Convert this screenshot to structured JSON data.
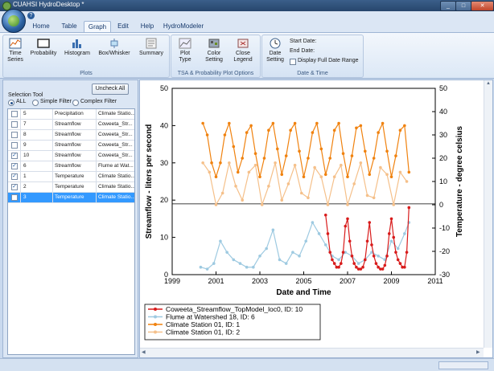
{
  "window": {
    "title": "CUAHSI HydroDesktop *"
  },
  "quick_access": {
    "help_glyph": "?"
  },
  "tabs": [
    {
      "label": "Home",
      "active": false
    },
    {
      "label": "Table",
      "active": false
    },
    {
      "label": "Graph",
      "active": true
    },
    {
      "label": "Edit",
      "active": false
    },
    {
      "label": "Help",
      "active": false
    },
    {
      "label": "HydroModeler",
      "active": false
    }
  ],
  "ribbon": {
    "plots_group": {
      "label": "Plots",
      "buttons": [
        {
          "label": "Time Series",
          "icon": "time-series-icon"
        },
        {
          "label": "Probability",
          "icon": "probability-icon"
        },
        {
          "label": "Histogram",
          "icon": "histogram-icon"
        },
        {
          "label": "Box/Whisker",
          "icon": "box-whisker-icon"
        },
        {
          "label": "Summary",
          "icon": "summary-icon"
        }
      ]
    },
    "options_group": {
      "label": "TSA & Probability Plot Options",
      "buttons": [
        {
          "label": "Plot Type",
          "icon": "plot-type-icon"
        },
        {
          "label": "Color Setting",
          "icon": "color-setting-icon"
        },
        {
          "label": "Close Legend",
          "icon": "close-legend-icon"
        }
      ]
    },
    "date_group": {
      "label": "Date & Time",
      "date_setting_label": "Date Setting",
      "start_date_label": "Start Date:",
      "end_date_label": "End Date:",
      "display_full_label": "Display Full Date Range"
    }
  },
  "left_panel": {
    "uncheck_all": "Uncheck All",
    "selection_tool": "Selection Tool",
    "filters": [
      {
        "label": "ALL",
        "selected": true
      },
      {
        "label": "Simple Filter",
        "selected": false
      },
      {
        "label": "Complex Filter",
        "selected": false
      }
    ],
    "rows": [
      {
        "checked": false,
        "id": "5",
        "variable": "Precipitation",
        "site": "Climate Statio...",
        "selected": false
      },
      {
        "checked": false,
        "id": "7",
        "variable": "Streamflow",
        "site": "Coweeta_Str...",
        "selected": false
      },
      {
        "checked": false,
        "id": "8",
        "variable": "Streamflow",
        "site": "Coweeta_Str...",
        "selected": false
      },
      {
        "checked": false,
        "id": "9",
        "variable": "Streamflow",
        "site": "Coweeta_Str...",
        "selected": false
      },
      {
        "checked": true,
        "id": "10",
        "variable": "Streamflow",
        "site": "Coweeta_Str...",
        "selected": false
      },
      {
        "checked": true,
        "id": "6",
        "variable": "Streamflow",
        "site": "Flume at Wat...",
        "selected": false
      },
      {
        "checked": true,
        "id": "1",
        "variable": "Temperature",
        "site": "Climate Statio...",
        "selected": false
      },
      {
        "checked": true,
        "id": "2",
        "variable": "Temperature",
        "site": "Climate Statio...",
        "selected": false
      },
      {
        "checked": false,
        "id": "3",
        "variable": "Temperature",
        "site": "Climate Statio...",
        "selected": true
      }
    ]
  },
  "chart_data": {
    "type": "scatter",
    "xlabel": "Date and Time",
    "ylabel": "Streamflow - liters per second",
    "y2label": "Temperature - degree celsius",
    "xlim": [
      1999,
      2011
    ],
    "ylim": [
      0,
      50
    ],
    "y2lim": [
      -30,
      50
    ],
    "x_ticks": [
      "1999",
      "2001",
      "2003",
      "2005",
      "2007",
      "2009",
      "2011"
    ],
    "y_ticks": [
      "0",
      "10",
      "20",
      "30",
      "40",
      "50"
    ],
    "y2_ticks": [
      "-30",
      "-20",
      "-10",
      "0",
      "10",
      "20",
      "30",
      "40",
      "50"
    ],
    "reference_line_y": 19,
    "legend_position": "bottom-left",
    "series": [
      {
        "name": "Coweeta_Streamflow_TopModel_loc0, ID: 10",
        "color": "#d81b1b",
        "axis": "left",
        "x": [
          2006.0,
          2006.1,
          2006.2,
          2006.3,
          2006.4,
          2006.5,
          2006.6,
          2006.7,
          2006.8,
          2006.9,
          2007.0,
          2007.1,
          2007.2,
          2007.3,
          2007.4,
          2007.5,
          2007.6,
          2007.7,
          2007.8,
          2007.9,
          2008.0,
          2008.1,
          2008.2,
          2008.3,
          2008.4,
          2008.5,
          2008.6,
          2008.7,
          2008.8,
          2008.9,
          2009.0,
          2009.1,
          2009.2,
          2009.3,
          2009.4,
          2009.5,
          2009.6,
          2009.7,
          2009.8
        ],
        "y": [
          16,
          11,
          6,
          4,
          3,
          2,
          2,
          3,
          6,
          13,
          15,
          9,
          5,
          3,
          2,
          1.5,
          1.5,
          2,
          4,
          9,
          14,
          8,
          5,
          3,
          2,
          1.5,
          1.5,
          2.5,
          5,
          11,
          15,
          10,
          6,
          4,
          3,
          2,
          2,
          6,
          18
        ]
      },
      {
        "name": "Flume at Watershed 18, ID: 6",
        "color": "#9ecae1",
        "axis": "left",
        "x": [
          2000.3,
          2000.6,
          2000.9,
          2001.2,
          2001.5,
          2001.8,
          2002.1,
          2002.4,
          2002.7,
          2003.0,
          2003.3,
          2003.6,
          2003.9,
          2004.2,
          2004.5,
          2004.8,
          2005.1,
          2005.4,
          2005.7,
          2006.0,
          2006.3,
          2006.6,
          2006.9,
          2007.2,
          2007.5,
          2007.8,
          2008.1,
          2008.4,
          2008.7,
          2009.0,
          2009.3,
          2009.6,
          2009.8
        ],
        "y": [
          2,
          1.5,
          3,
          9,
          6,
          4,
          3,
          2,
          2,
          5,
          7,
          12,
          4,
          3,
          6,
          5,
          9,
          14,
          11,
          8,
          5,
          4,
          6,
          5,
          3,
          4,
          6,
          5,
          4,
          9,
          7,
          11,
          14
        ]
      },
      {
        "name": "Climate Station 01, ID: 1",
        "color": "#f0820f",
        "axis": "right",
        "x": [
          2000.4,
          2000.6,
          2000.8,
          2001.0,
          2001.2,
          2001.4,
          2001.6,
          2001.8,
          2002.0,
          2002.2,
          2002.4,
          2002.6,
          2002.8,
          2003.0,
          2003.2,
          2003.4,
          2003.6,
          2003.8,
          2004.0,
          2004.2,
          2004.4,
          2004.6,
          2004.8,
          2005.0,
          2005.2,
          2005.4,
          2005.6,
          2005.8,
          2006.0,
          2006.2,
          2006.4,
          2006.6,
          2006.8,
          2007.0,
          2007.2,
          2007.4,
          2007.6,
          2007.8,
          2008.0,
          2008.2,
          2008.4,
          2008.6,
          2008.8,
          2009.0,
          2009.2,
          2009.4,
          2009.6,
          2009.8
        ],
        "y": [
          35,
          30,
          18,
          12,
          18,
          30,
          35,
          25,
          14,
          20,
          31,
          34,
          22,
          12,
          20,
          32,
          35,
          24,
          13,
          21,
          32,
          35,
          23,
          12,
          20,
          31,
          35,
          24,
          13,
          20,
          32,
          35,
          22,
          12,
          21,
          33,
          34,
          23,
          13,
          20,
          31,
          35,
          23,
          12,
          21,
          32,
          34,
          14
        ]
      },
      {
        "name": "Climate Station 01, ID: 2",
        "color": "#f5c08a",
        "axis": "right",
        "x": [
          2000.4,
          2000.7,
          2001.0,
          2001.3,
          2001.6,
          2001.9,
          2002.2,
          2002.5,
          2002.8,
          2003.1,
          2003.4,
          2003.7,
          2004.0,
          2004.3,
          2004.6,
          2004.9,
          2005.2,
          2005.5,
          2005.8,
          2006.1,
          2006.4,
          2006.7,
          2007.0,
          2007.3,
          2007.6,
          2007.9,
          2008.2,
          2008.5,
          2008.8,
          2009.1,
          2009.4,
          2009.7
        ],
        "y": [
          18,
          14,
          0,
          5,
          18,
          8,
          2,
          14,
          17,
          0,
          8,
          18,
          2,
          9,
          17,
          5,
          3,
          16,
          12,
          0,
          12,
          17,
          0,
          9,
          18,
          4,
          3,
          16,
          13,
          0,
          14,
          10
        ]
      }
    ]
  }
}
